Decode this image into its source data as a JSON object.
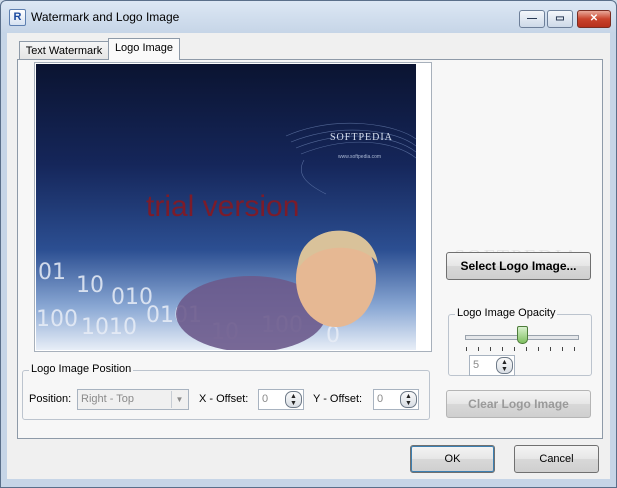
{
  "window": {
    "title": "Watermark and Logo Image",
    "app_icon_letter": "R",
    "minimize_glyph": "—",
    "maximize_glyph": "▭",
    "close_glyph": "✕"
  },
  "tabs": [
    {
      "label": "Text Watermark",
      "active": false
    },
    {
      "label": "Logo Image",
      "active": true
    }
  ],
  "preview": {
    "overlay_text": "trial version",
    "brand_text": "SOFTPEDIA",
    "brand_url": "www.softpedia.com"
  },
  "position_group": {
    "title": "Logo Image Position",
    "position_label": "Position:",
    "position_value": "Right - Top",
    "x_offset_label": "X - Offset:",
    "x_offset_value": "0",
    "y_offset_label": "Y - Offset:",
    "y_offset_value": "0"
  },
  "select_logo_button": "Select Logo Image...",
  "opacity_group": {
    "title": "Logo Image Opacity",
    "value": "5",
    "slider_level_fraction": 0.5
  },
  "clear_logo_button": "Clear Logo Image",
  "background_watermark": "SOFTPEDIA",
  "footer": {
    "ok_label": "OK",
    "cancel_label": "Cancel"
  },
  "colors": {
    "overlay_text": "#7c1c2a",
    "close_button": "#c9432c"
  }
}
